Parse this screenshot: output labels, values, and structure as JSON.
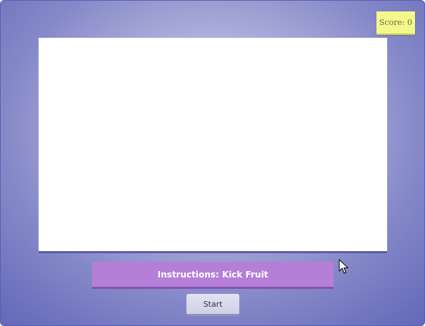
{
  "hud": {
    "score_text": "Score: 0"
  },
  "instructions": {
    "text": "Instructions: Kick Fruit"
  },
  "controls": {
    "start_label": "Start"
  },
  "colors": {
    "background_center": "#d7d9ee",
    "background_edge": "#6468b8",
    "score_badge": "#f4f88a",
    "instructions_bar": "#b57fd8",
    "canvas": "#ffffff"
  }
}
